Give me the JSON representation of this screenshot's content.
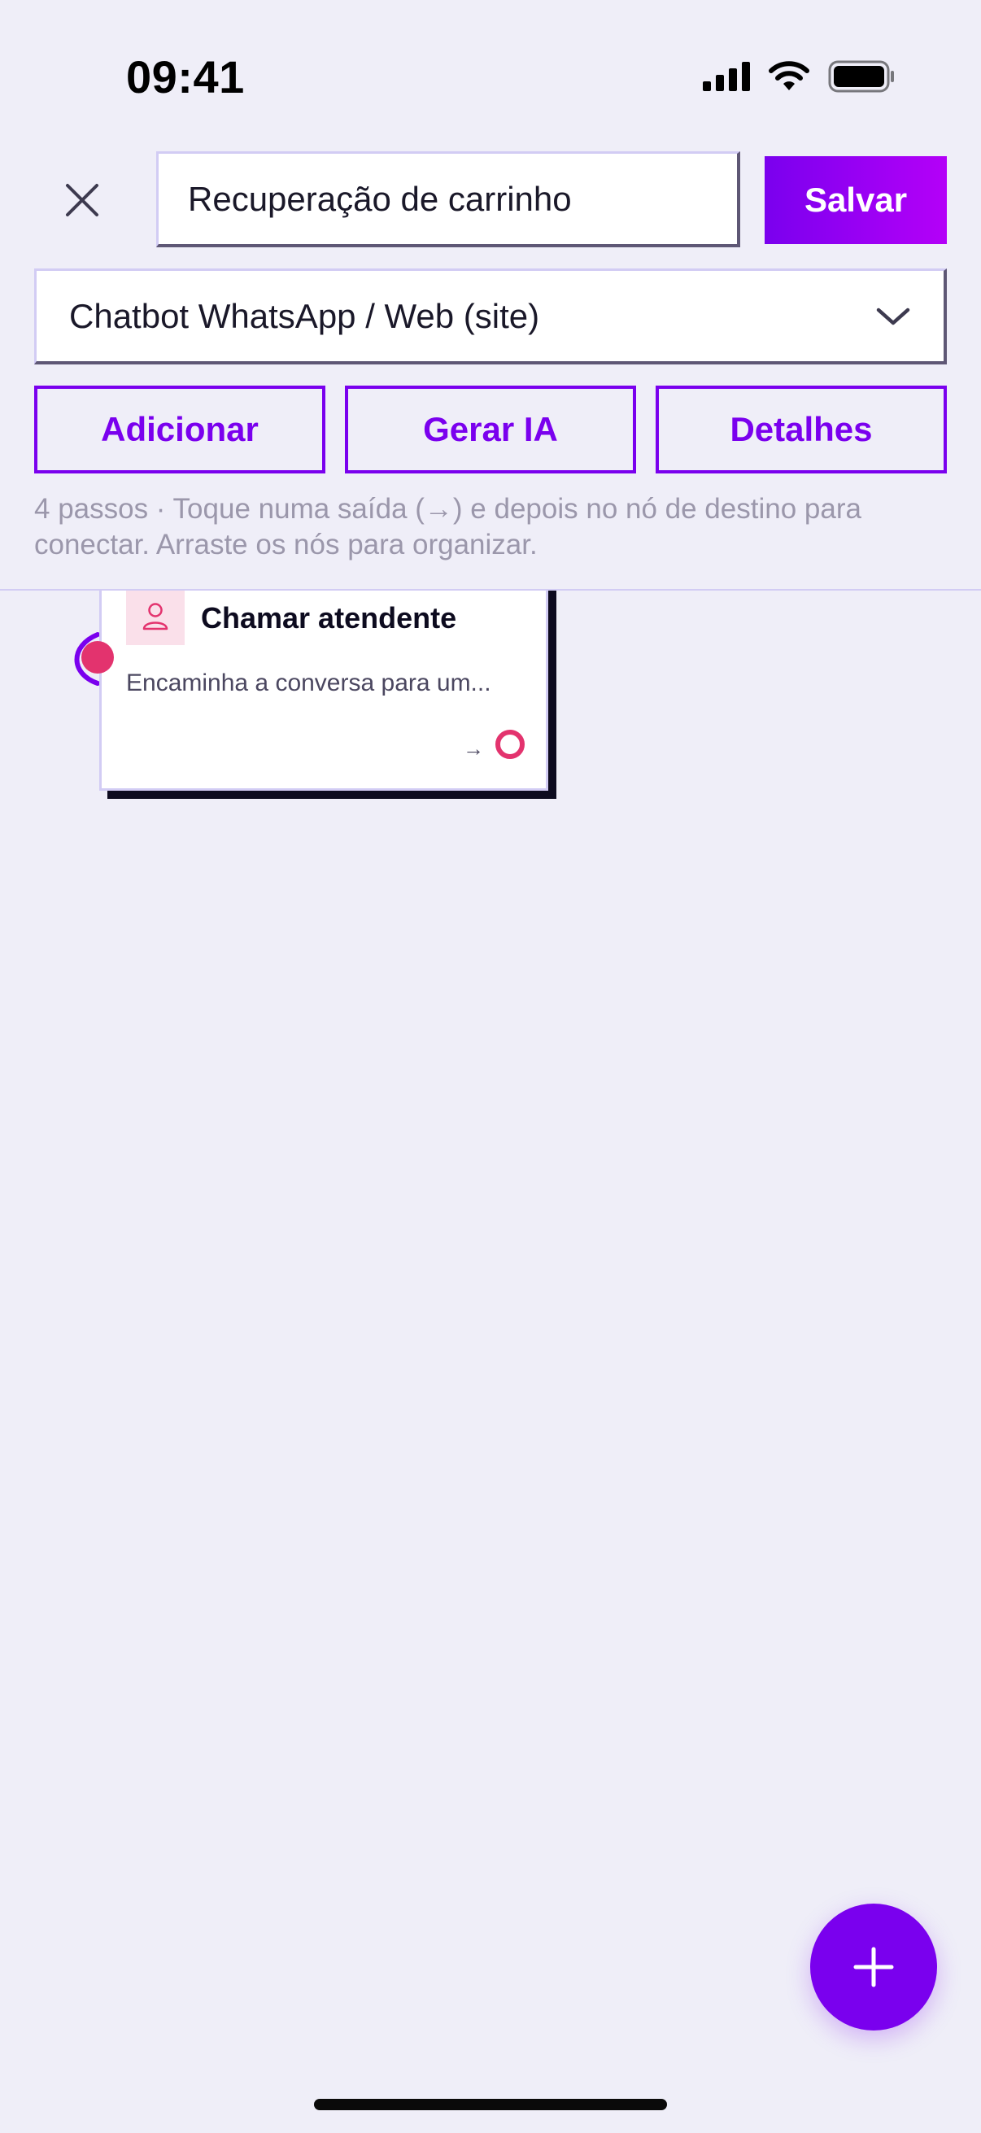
{
  "status_bar": {
    "time": "09:41"
  },
  "header": {
    "title_value": "Recuperação de carrinho",
    "save_label": "Salvar"
  },
  "channel_select": {
    "selected": "Chatbot WhatsApp / Web (site)"
  },
  "actions": {
    "add_label": "Adicionar",
    "ai_label": "Gerar IA",
    "details_label": "Detalhes"
  },
  "hint": "4 passos · Toque numa saída (→) e depois no nó de destino para conectar. Arraste os nós para organizar.",
  "canvas": {
    "nodes": [
      {
        "title": "Chamar atendente",
        "description": "Encaminha a conversa para um...",
        "icon": "person-icon",
        "output_arrow": "→"
      }
    ]
  },
  "colors": {
    "accent": "#7a00ee",
    "node_pink": "#e3336e",
    "background": "#efeef8"
  }
}
